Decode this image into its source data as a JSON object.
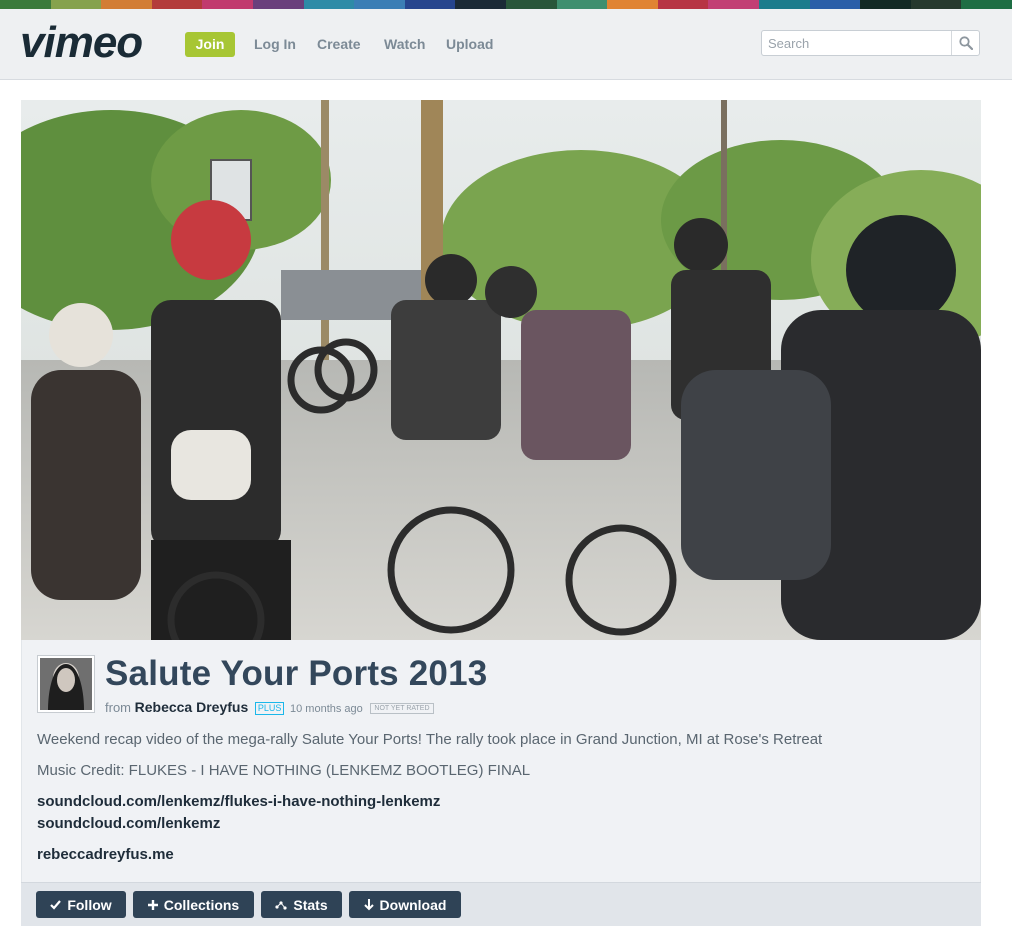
{
  "colors": {
    "accent_green": "#a7c634",
    "nav_text": "#7c8a96",
    "title": "#33475b",
    "button_dark": "#2f4356",
    "stripe": [
      "#3a7a3b",
      "#86a24d",
      "#d27d35",
      "#b33b3b",
      "#c13a6e",
      "#6a3f7c",
      "#2e8ba7",
      "#3b7eb5",
      "#26458e",
      "#1b2a36",
      "#29563a",
      "#3f8f6f",
      "#e08433",
      "#b73545",
      "#c23f74",
      "#1c7c8c",
      "#2a5ea8",
      "#132a25",
      "#26392e",
      "#1e6e44"
    ]
  },
  "header": {
    "logo_icon": "vimeo-logo",
    "join_label": "Join",
    "nav": [
      {
        "label": "Log In"
      },
      {
        "label": "Create"
      },
      {
        "label": "Watch"
      },
      {
        "label": "Upload"
      }
    ],
    "search_placeholder": "Search",
    "search_icon": "search-icon"
  },
  "video": {
    "thumbnail": "motorcycle-rally-frame"
  },
  "info": {
    "title": "Salute Your Ports 2013",
    "from_label": "from",
    "author": "Rebecca Dreyfus",
    "plus_badge": "PLUS",
    "time_ago": "10 months ago",
    "rating": "NOT YET RATED",
    "description": "Weekend recap video of the mega-rally Salute Your Ports! The rally took place in Grand Junction, MI at Rose's Retreat",
    "music_credit": "Music Credit: FLUKES - I HAVE NOTHING (LENKEMZ BOOTLEG) FINAL",
    "links": [
      "soundcloud.com/lenkemz/flukes-i-have-nothing-lenkemz",
      "soundcloud.com/lenkemz",
      "rebeccadreyfus.me"
    ]
  },
  "actions": [
    {
      "label": "Follow",
      "icon": "check-icon"
    },
    {
      "label": "Collections",
      "icon": "plus-icon"
    },
    {
      "label": "Stats",
      "icon": "stats-icon"
    },
    {
      "label": "Download",
      "icon": "download-icon"
    }
  ]
}
